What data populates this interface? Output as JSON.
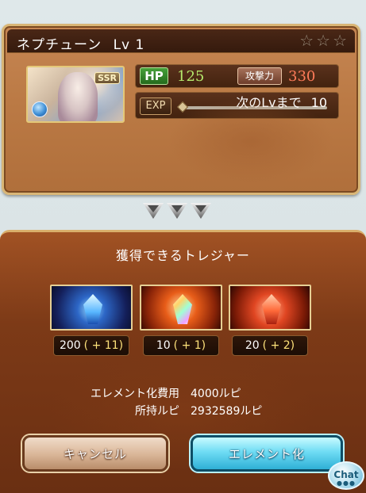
{
  "character": {
    "name": "ネプチューン",
    "level_text": "Lv 1",
    "rarity_badge": "SSR",
    "stars_total": 3,
    "stars_filled": 0
  },
  "stats": {
    "hp_label": "HP",
    "hp_value": "125",
    "atk_label": "攻撃力",
    "atk_value": "330",
    "exp_label": "EXP",
    "next_level_label": "次のLvまで",
    "next_level_value": "10",
    "exp_progress": 0.0
  },
  "treasure": {
    "heading": "獲得できるトレジャー",
    "items": [
      {
        "icon": "blue-crystal-icon",
        "count": "200",
        "bonus": "( + 11)"
      },
      {
        "icon": "prism-crystal-icon",
        "count": "10",
        "bonus": "( + 1)"
      },
      {
        "icon": "red-crystal-icon",
        "count": "20",
        "bonus": "( + 2)"
      }
    ]
  },
  "cost": {
    "fee_label": "エレメント化費用",
    "fee_value": "4000ルピ",
    "owned_label": "所持ルピ",
    "owned_value": "2932589ルピ"
  },
  "buttons": {
    "cancel_label": "キャンセル",
    "element_label": "エレメント化"
  },
  "chat": {
    "label": "Chat",
    "dots": "●●●"
  },
  "colors": {
    "hp_value": "#b6ea6d",
    "atk_value": "#ff7b59",
    "bonus": "#ffe27a"
  }
}
